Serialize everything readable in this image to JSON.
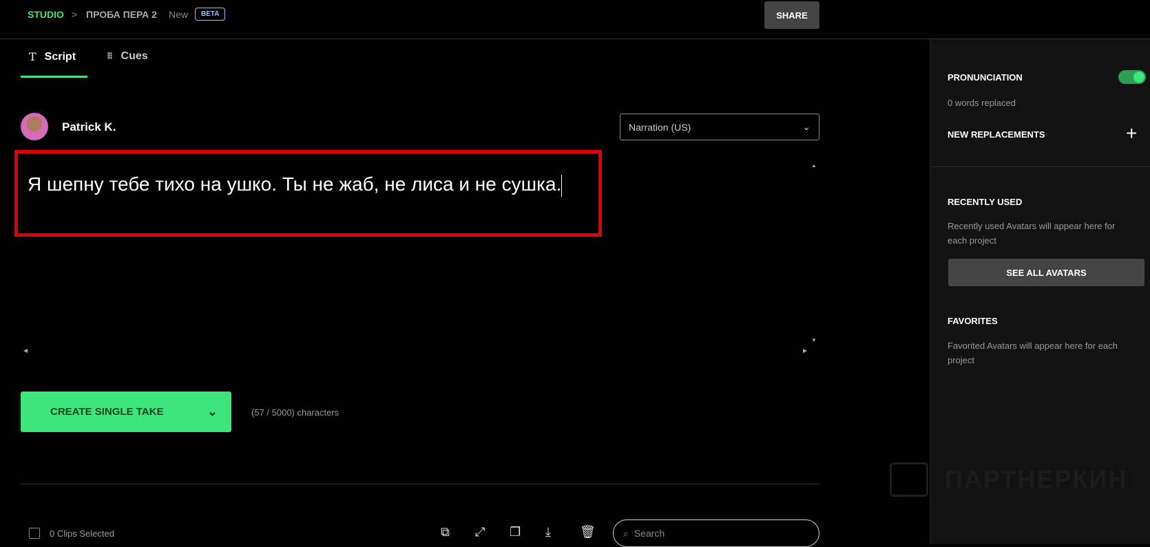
{
  "header": {
    "studio": "STUDIO",
    "separator": ">",
    "project": "ПРОБА ПЕРА 2",
    "status": "New",
    "beta": "BETA",
    "share": "SHARE"
  },
  "tabs": [
    {
      "label": "Script",
      "icon": "text-icon"
    },
    {
      "label": "Cues",
      "icon": "sliders-icon"
    }
  ],
  "speaker": {
    "name": "Patrick K.",
    "style": "Narration (US)"
  },
  "script": {
    "text": "Я шепну тебе тихо на ушко. Ты не жаб, не лиса и не сушка."
  },
  "create": {
    "label": "CREATE SINGLE TAKE",
    "chars": "(57 / 5000) characters"
  },
  "footer": {
    "clips": "0 Clips Selected",
    "search_placeholder": "Search"
  },
  "sidebar": {
    "pronunciation": "PRONUNCIATION",
    "pronunciation_on": true,
    "words_replaced": "0 words replaced",
    "new_replacements": "NEW REPLACEMENTS",
    "recently_used": "RECENTLY USED",
    "recently_desc": "Recently used Avatars will appear here for each project",
    "see_all": "SEE ALL AVATARS",
    "favorites": "FAVORITES",
    "favorites_desc": "Favorited Avatars will appear here for each project"
  },
  "watermark": "ПАРТНЕРКИН",
  "colors": {
    "accent": "#3ee57a",
    "highlight": "#e00000"
  }
}
